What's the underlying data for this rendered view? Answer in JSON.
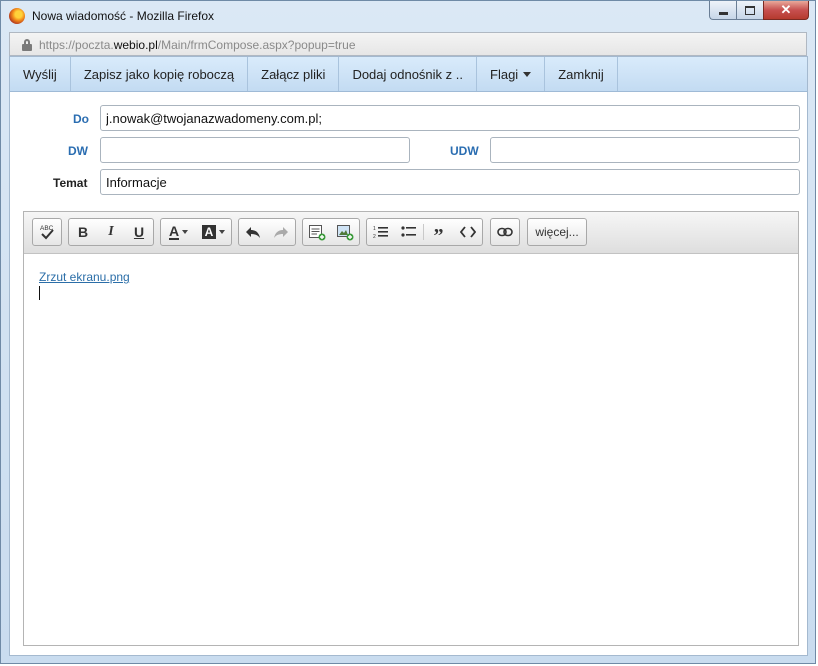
{
  "window": {
    "title": "Nowa wiadomość - Mozilla Firefox",
    "url_prefix": "https://poczta.",
    "url_domain": "webio.pl",
    "url_path": "/Main/frmCompose.aspx?popup=true"
  },
  "toolbar": {
    "send": "Wyślij",
    "save_draft": "Zapisz jako kopię roboczą",
    "attach": "Załącz pliki",
    "add_link": "Dodaj odnośnik z ..",
    "flags": "Flagi",
    "close": "Zamknij"
  },
  "form": {
    "to_label": "Do",
    "to_value": "j.nowak@twojanazwadomeny.com.pl;",
    "cc_label": "DW",
    "cc_value": "",
    "bcc_label": "UDW",
    "bcc_value": "",
    "subject_label": "Temat",
    "subject_value": "Informacje"
  },
  "editor": {
    "more_label": "więcej...",
    "attachment_link": "Zrzut ekranu.png"
  },
  "icons": {
    "spellcheck": "spellcheck-icon",
    "bold": "bold-icon",
    "italic": "italic-icon",
    "underline": "underline-icon",
    "font_color": "font-color-icon",
    "background_color": "background-color-icon",
    "undo": "undo-icon",
    "redo": "redo-icon",
    "insert_table": "insert-table-icon",
    "insert_image": "insert-image-icon",
    "ordered_list": "ordered-list-icon",
    "unordered_list": "unordered-list-icon",
    "blockquote": "blockquote-icon",
    "source_code": "source-code-icon",
    "link": "link-icon"
  },
  "colors": {
    "label_blue": "#2a6db1",
    "link_blue": "#2b6ea8",
    "toolbar_bg": "#d9ebfb"
  }
}
